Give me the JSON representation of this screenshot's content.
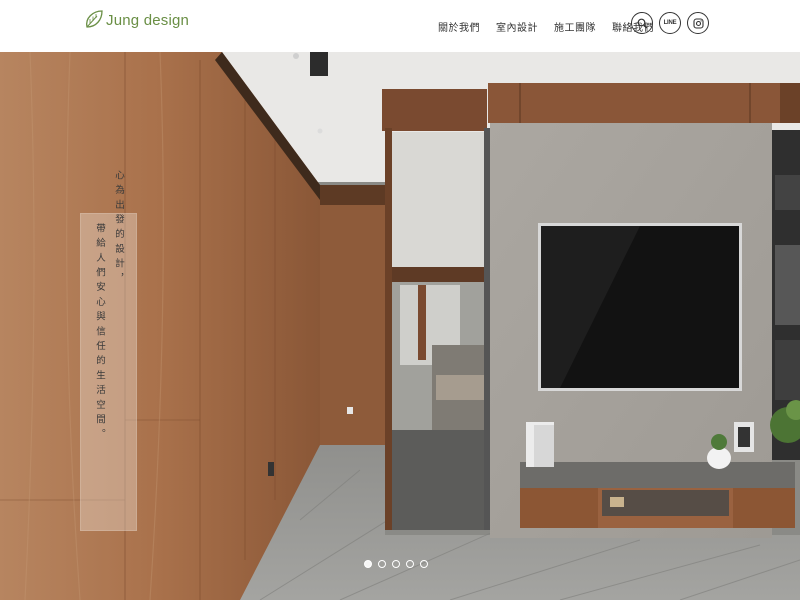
{
  "header": {
    "logo_text": "Jung design",
    "nav": [
      "關於我們",
      "室內設計",
      "施工團隊",
      "聯絡我們"
    ],
    "line_label": "LINE"
  },
  "hero": {
    "quote_lines": [
      "心為出發的設計，",
      "帶給人們安心與信任的生活空間。"
    ],
    "slides_count": 5,
    "active_slide": 1
  },
  "colors": {
    "brand_green": "#6a8f45",
    "wood": "#a86f4a",
    "stone": "#a7a39d"
  }
}
